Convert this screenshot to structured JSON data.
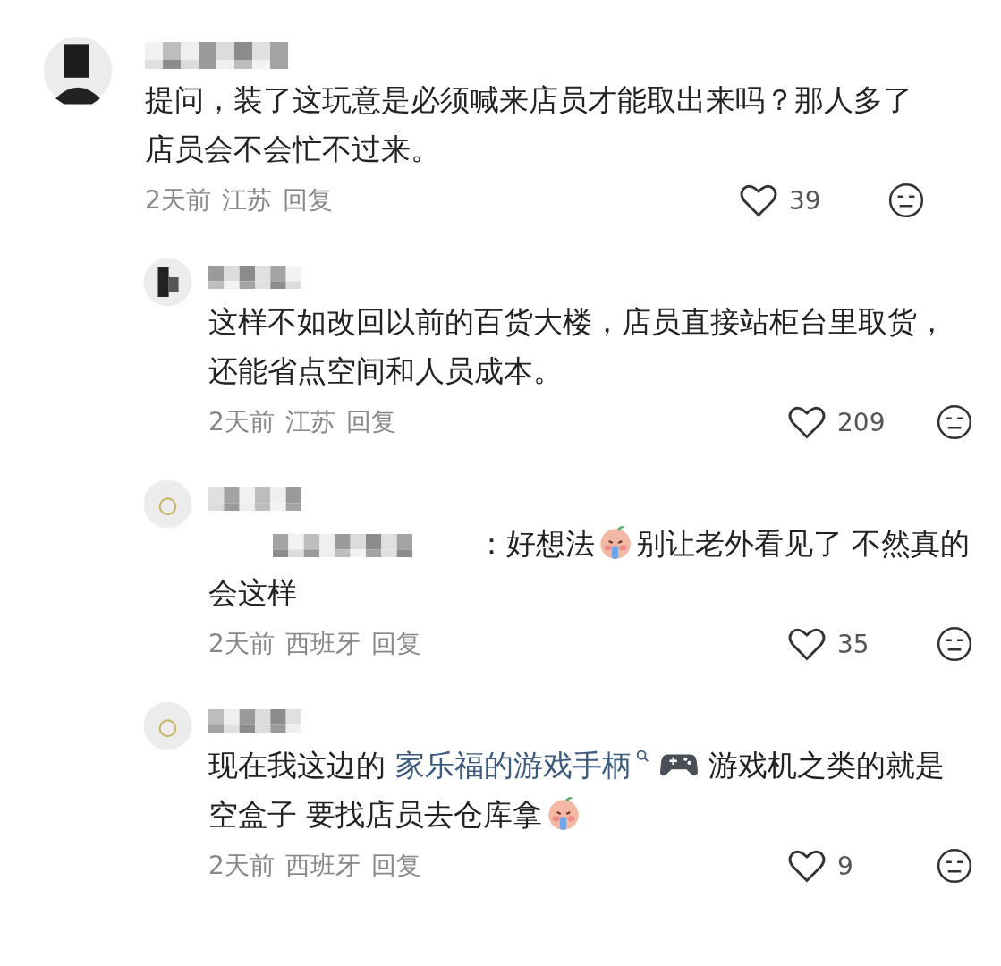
{
  "comments": [
    {
      "kind": "top",
      "content": [
        {
          "kind": "text",
          "text": "提问，装了这玩意是必须喊来店员才能取出来吗？那人多了店员会不会忙不过来。"
        }
      ],
      "time": "2天前",
      "location": "江苏",
      "reply_label": "回复",
      "likes": "39",
      "liked": false
    },
    {
      "kind": "reply",
      "content": [
        {
          "kind": "text",
          "text": "这样不如改回以前的百货大楼，店员直接站柜台里取货，还能省点空间和人员成本。"
        }
      ],
      "time": "2天前",
      "location": "江苏",
      "reply_label": "回复",
      "likes": "209",
      "liked": false
    },
    {
      "kind": "reply",
      "content": [
        {
          "kind": "redacted"
        },
        {
          "kind": "text",
          "text": "：好想法"
        },
        {
          "kind": "emoji"
        },
        {
          "kind": "text",
          "text": "别让老外看见了 不然真的会这样"
        }
      ],
      "time": "2天前",
      "location": "西班牙",
      "reply_label": "回复",
      "likes": "35",
      "liked": false
    },
    {
      "kind": "reply",
      "content": [
        {
          "kind": "text",
          "text": "现在我这边的 "
        },
        {
          "kind": "link",
          "text": "家乐福的游戏手柄"
        },
        {
          "kind": "gamepad"
        },
        {
          "kind": "text",
          "text": " 游戏机之类的就是空盒子 要找店员去仓库拿"
        },
        {
          "kind": "emoji"
        }
      ],
      "time": "2天前",
      "location": "西班牙",
      "reply_label": "回复",
      "likes": "9",
      "liked": false
    }
  ]
}
